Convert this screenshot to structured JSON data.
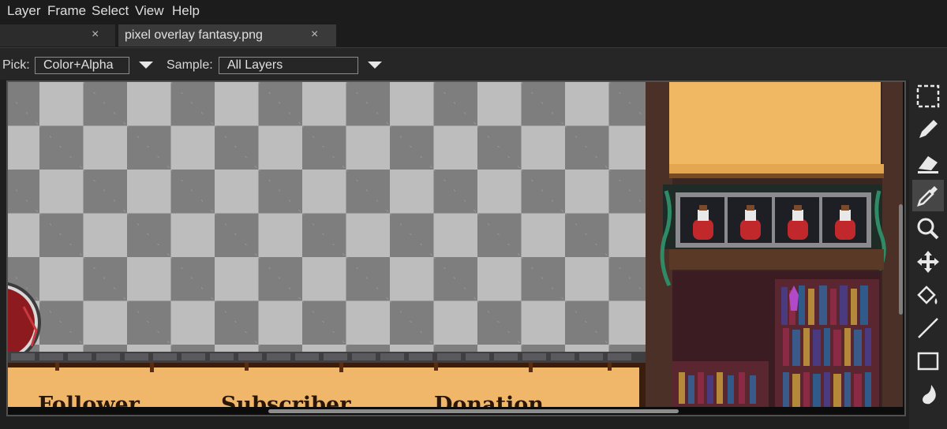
{
  "menu": [
    "Layer",
    "Frame",
    "Select",
    "View",
    "Help"
  ],
  "tabs": [
    {
      "label": "",
      "close": "×",
      "active": false
    },
    {
      "label": "pixel overlay fantasy.png",
      "close": "×",
      "active": true
    }
  ],
  "options": {
    "pick_label": "Pick:",
    "pick_value": "Color+Alpha",
    "sample_label": "Sample:",
    "sample_value": "All Layers"
  },
  "canvas": {
    "banner_labels": [
      "Follower",
      "Subscriber",
      "Donation"
    ],
    "potion_count": 4
  },
  "tools": [
    {
      "name": "rectangle-select-icon",
      "active": false
    },
    {
      "name": "pencil-icon",
      "active": false
    },
    {
      "name": "eraser-icon",
      "active": false
    },
    {
      "name": "eyedropper-icon",
      "active": true
    },
    {
      "name": "zoom-icon",
      "active": false
    },
    {
      "name": "move-icon",
      "active": false
    },
    {
      "name": "paint-bucket-icon",
      "active": false
    },
    {
      "name": "line-icon",
      "active": false
    },
    {
      "name": "rectangle-icon",
      "active": false
    },
    {
      "name": "ink-drop-icon",
      "active": false
    }
  ]
}
